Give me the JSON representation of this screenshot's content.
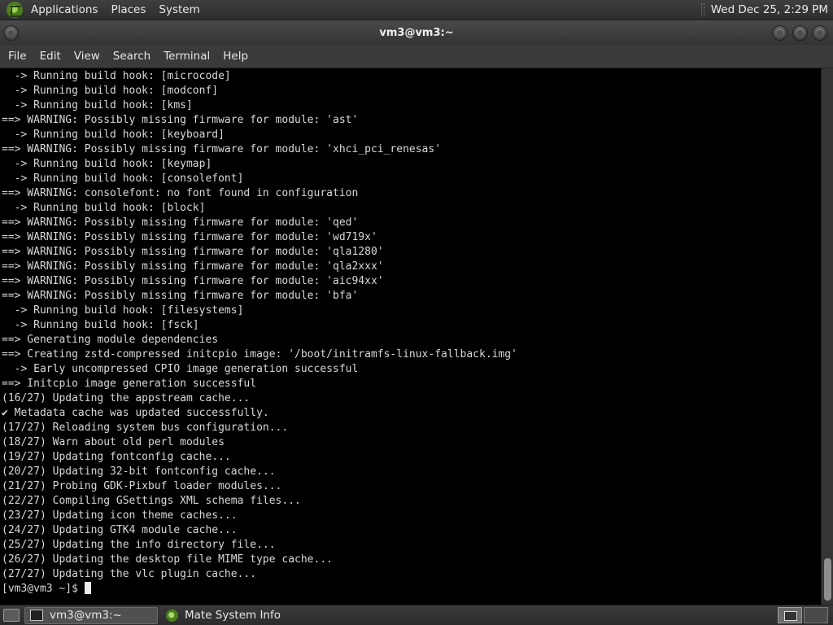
{
  "top_panel": {
    "menus": [
      "Applications",
      "Places",
      "System"
    ],
    "clock": "Wed Dec 25,  2:29 PM"
  },
  "window": {
    "title": "vm3@vm3:~"
  },
  "menubar": [
    "File",
    "Edit",
    "View",
    "Search",
    "Terminal",
    "Help"
  ],
  "terminal": {
    "lines": [
      "  -> Running build hook: [microcode]",
      "  -> Running build hook: [modconf]",
      "  -> Running build hook: [kms]",
      "==> WARNING: Possibly missing firmware for module: 'ast'",
      "  -> Running build hook: [keyboard]",
      "==> WARNING: Possibly missing firmware for module: 'xhci_pci_renesas'",
      "  -> Running build hook: [keymap]",
      "  -> Running build hook: [consolefont]",
      "==> WARNING: consolefont: no font found in configuration",
      "  -> Running build hook: [block]",
      "==> WARNING: Possibly missing firmware for module: 'qed'",
      "==> WARNING: Possibly missing firmware for module: 'wd719x'",
      "==> WARNING: Possibly missing firmware for module: 'qla1280'",
      "==> WARNING: Possibly missing firmware for module: 'qla2xxx'",
      "==> WARNING: Possibly missing firmware for module: 'aic94xx'",
      "==> WARNING: Possibly missing firmware for module: 'bfa'",
      "  -> Running build hook: [filesystems]",
      "  -> Running build hook: [fsck]",
      "==> Generating module dependencies",
      "==> Creating zstd-compressed initcpio image: '/boot/initramfs-linux-fallback.img'",
      "  -> Early uncompressed CPIO image generation successful",
      "==> Initcpio image generation successful",
      "(16/27) Updating the appstream cache...",
      "✔ Metadata cache was updated successfully.",
      "(17/27) Reloading system bus configuration...",
      "(18/27) Warn about old perl modules",
      "(19/27) Updating fontconfig cache...",
      "(20/27) Updating 32-bit fontconfig cache...",
      "(21/27) Probing GDK-Pixbuf loader modules...",
      "(22/27) Compiling GSettings XML schema files...",
      "(23/27) Updating icon theme caches...",
      "(24/27) Updating GTK4 module cache...",
      "(25/27) Updating the info directory file...",
      "(26/27) Updating the desktop file MIME type cache...",
      "(27/27) Updating the vlc plugin cache..."
    ],
    "prompt": "[vm3@vm3 ~]$ "
  },
  "taskbar": {
    "tasks": [
      "vm3@vm3:~",
      "Mate System Info"
    ]
  }
}
